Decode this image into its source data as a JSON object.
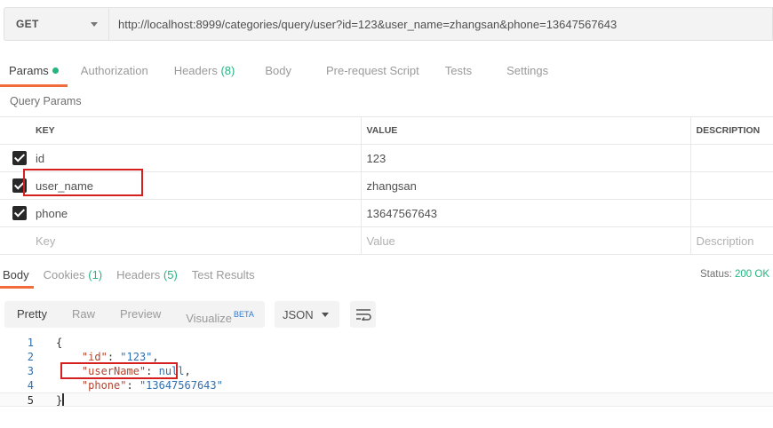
{
  "request": {
    "method": "GET",
    "url": "http://localhost:8999/categories/query/user?id=123&user_name=zhangsan&phone=13647567643"
  },
  "request_tabs": {
    "params": "Params",
    "authorization": "Authorization",
    "headers": "Headers",
    "headers_count": "(8)",
    "body": "Body",
    "prerequest": "Pre-request Script",
    "tests": "Tests",
    "settings": "Settings"
  },
  "query_params": {
    "title": "Query Params",
    "columns": {
      "key": "KEY",
      "value": "VALUE",
      "description": "DESCRIPTION"
    },
    "rows": [
      {
        "key": "id",
        "value": "123",
        "description": "",
        "checked": true
      },
      {
        "key": "user_name",
        "value": "zhangsan",
        "description": "",
        "checked": true
      },
      {
        "key": "phone",
        "value": "13647567643",
        "description": "",
        "checked": true
      }
    ],
    "placeholder": {
      "key": "Key",
      "value": "Value",
      "description": "Description"
    }
  },
  "response_tabs": {
    "body": "Body",
    "cookies": "Cookies",
    "cookies_count": "(1)",
    "headers": "Headers",
    "headers_count": "(5)",
    "test_results": "Test Results"
  },
  "status": {
    "label": "Status:",
    "value": "200 OK"
  },
  "response_toolbar": {
    "pretty": "Pretty",
    "raw": "Raw",
    "preview": "Preview",
    "visualize": "Visualize",
    "beta": "BETA",
    "language": "JSON"
  },
  "response_body": {
    "line_numbers": [
      "1",
      "2",
      "3",
      "4",
      "5"
    ],
    "open_brace": "{",
    "close_brace": "}",
    "id_key": "\"id\"",
    "id_value": "\"123\"",
    "username_key": "\"userName\"",
    "username_value": "null",
    "phone_key": "\"phone\"",
    "phone_value": "\"13647567643\""
  },
  "colors": {
    "accent": "#f26b3a",
    "success": "#26b47f",
    "highlight_box": "#d62020"
  }
}
